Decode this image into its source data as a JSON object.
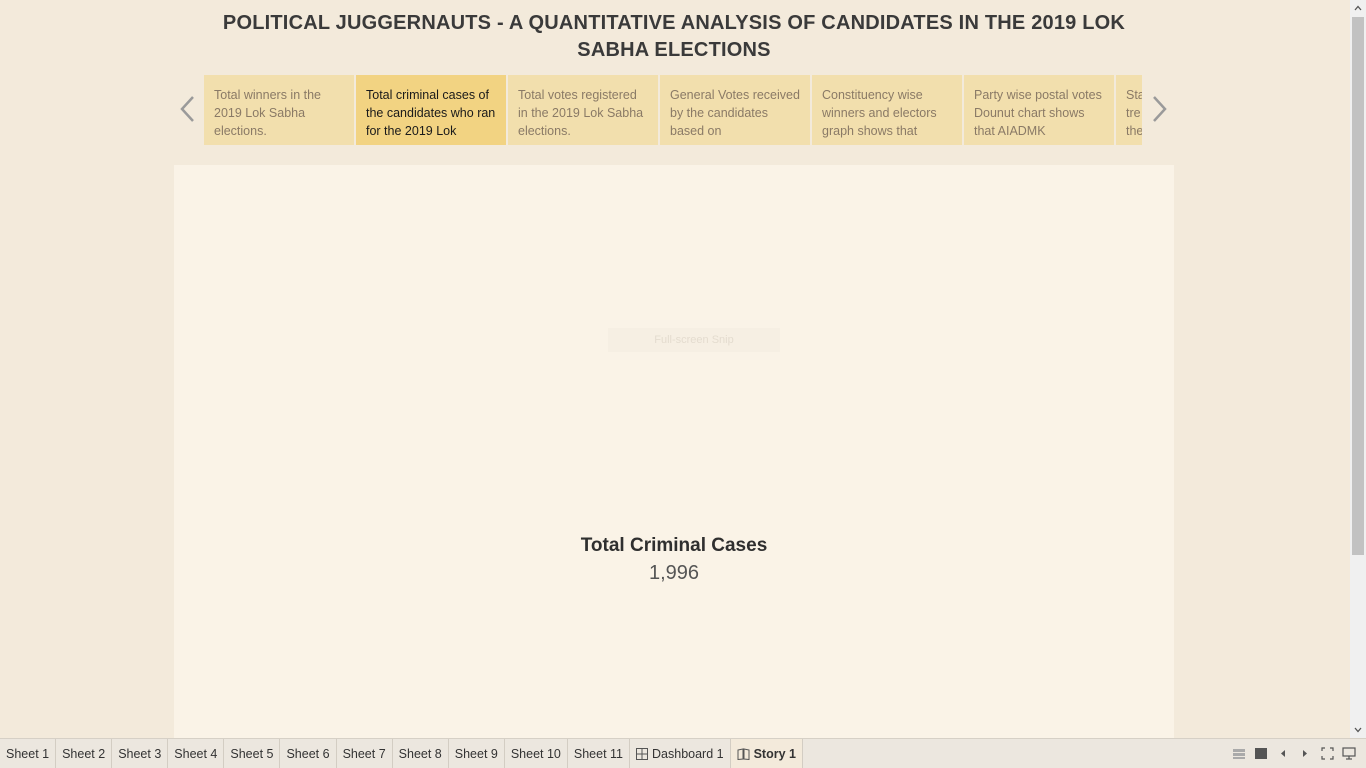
{
  "story": {
    "title": "POLITICAL JUGGERNAUTS - A QUANTITATIVE ANALYSIS OF CANDIDATES IN THE 2019 LOK SABHA ELECTIONS",
    "points": [
      {
        "text": "Total winners in the 2019 Lok Sabha elections.",
        "active": false
      },
      {
        "text": "Total criminal cases of the candidates who ran for the 2019 Lok",
        "active": true
      },
      {
        "text": "Total votes registered in the 2019 Lok Sabha elections.",
        "active": false
      },
      {
        "text": "General Votes received by the candidates based on",
        "active": false
      },
      {
        "text": "Constituency wise winners and electors graph shows that",
        "active": false
      },
      {
        "text": "Party wise postal votes Dounut chart shows that AIADMK",
        "active": false
      },
      {
        "text": "Sta tre the",
        "active": false
      }
    ]
  },
  "content": {
    "snip_text": "Full-screen Snip",
    "kpi_title": "Total Criminal Cases",
    "kpi_value": "1,996"
  },
  "tabs": [
    {
      "label": "Sheet 1",
      "icon": "",
      "active": false
    },
    {
      "label": "Sheet 2",
      "icon": "",
      "active": false
    },
    {
      "label": "Sheet 3",
      "icon": "",
      "active": false
    },
    {
      "label": "Sheet 4",
      "icon": "",
      "active": false
    },
    {
      "label": "Sheet 5",
      "icon": "",
      "active": false
    },
    {
      "label": "Sheet 6",
      "icon": "",
      "active": false
    },
    {
      "label": "Sheet 7",
      "icon": "",
      "active": false
    },
    {
      "label": "Sheet 8",
      "icon": "",
      "active": false
    },
    {
      "label": "Sheet 9",
      "icon": "",
      "active": false
    },
    {
      "label": "Sheet 10",
      "icon": "",
      "active": false
    },
    {
      "label": "Sheet 11",
      "icon": "",
      "active": false
    },
    {
      "label": "Dashboard 1",
      "icon": "dashboard-icon",
      "active": false
    },
    {
      "label": "Story 1",
      "icon": "story-icon",
      "active": true
    }
  ],
  "tools": [
    "show-sheet-sorter-icon",
    "show-filmstrip-icon",
    "previous-sheet-icon",
    "next-sheet-icon",
    "fullscreen-icon",
    "presentation-mode-icon"
  ],
  "colors": {
    "background": "#f3eadb",
    "story_point": "#f2dfad",
    "story_point_active": "#f2d382",
    "content_panel": "#faf3e7"
  }
}
